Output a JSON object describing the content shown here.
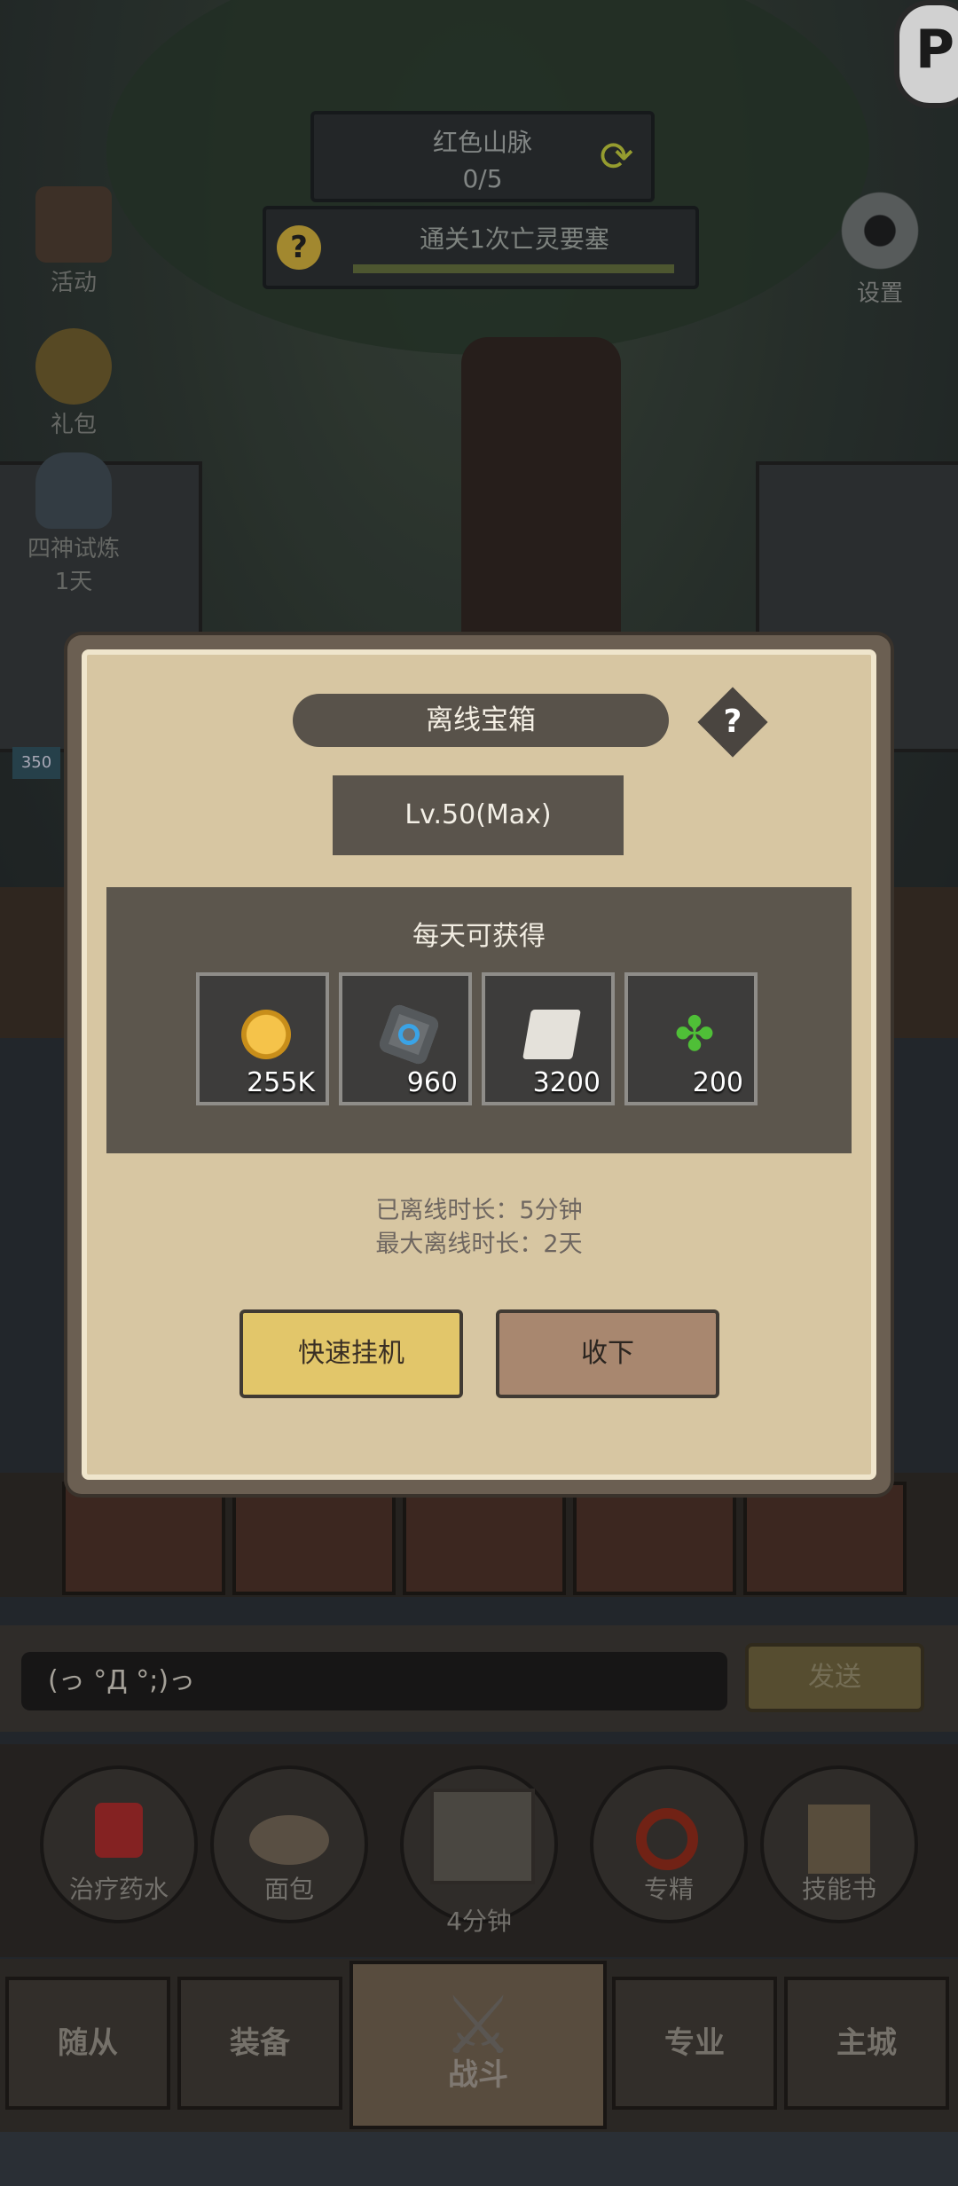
{
  "hud": {
    "quest_area": "红色山脉",
    "quest_progress": "0/5",
    "task_text": "通关1次亡灵要塞",
    "task_help": "?",
    "side_buttons": [
      "活动",
      "礼包",
      "四神试炼",
      "1天"
    ],
    "settings_label": "设置",
    "corner_logo": "P",
    "hp_badge": "350"
  },
  "modal": {
    "title": "离线宝箱",
    "help": "?",
    "level": "Lv.50(Max)",
    "reward_heading": "每天可获得",
    "rewards": [
      {
        "icon": "gold-coin-icon",
        "count": "255K"
      },
      {
        "icon": "rune-stone-icon",
        "count": "960"
      },
      {
        "icon": "scroll-icon",
        "count": "3200"
      },
      {
        "icon": "clover-icon",
        "count": "200"
      }
    ],
    "offline_time": "已离线时长：5分钟",
    "max_offline_time": "最大离线时长：2天",
    "fast_idle_button": "快速挂机",
    "collect_button": "收下"
  },
  "chat": {
    "input_value": "(っ °Д °;)っ",
    "send_label": "发送"
  },
  "items": [
    {
      "label": "治疗药水"
    },
    {
      "label": "面包"
    },
    {
      "label": "4分钟"
    },
    {
      "label": "专精"
    },
    {
      "label": "技能书"
    }
  ],
  "nav": {
    "tabs": [
      "随从",
      "装备",
      "战斗",
      "专业",
      "主城"
    ]
  },
  "colors": {
    "modal_bg": "#d7c6a2",
    "panel_dark": "#5c564d",
    "fast_button": "#e2c66a",
    "collect_button": "#a8876f"
  }
}
